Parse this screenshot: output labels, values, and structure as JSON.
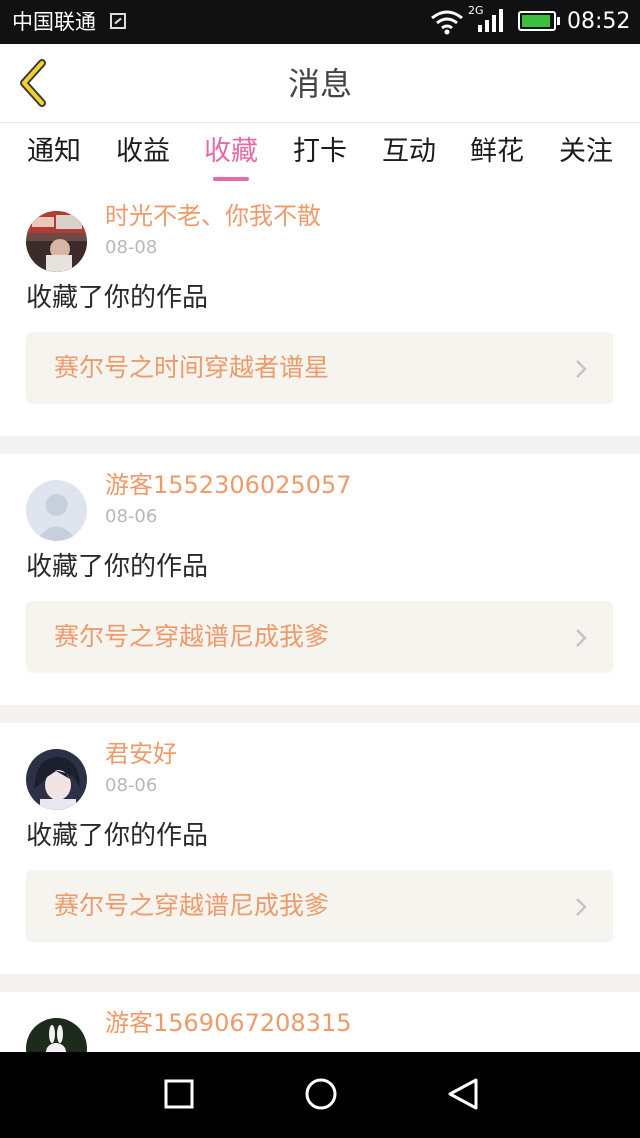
{
  "status_bar": {
    "carrier": "中国联通",
    "network_type": "2G",
    "time": "08:52",
    "icons": [
      "image-notification-icon",
      "wifi-icon",
      "signal-icon",
      "battery-charging-icon"
    ]
  },
  "header": {
    "title": "消息",
    "back_icon": "chevron-left-icon"
  },
  "tabs": [
    {
      "label": "通知",
      "active": false
    },
    {
      "label": "收益",
      "active": false
    },
    {
      "label": "收藏",
      "active": true
    },
    {
      "label": "打卡",
      "active": false
    },
    {
      "label": "互动",
      "active": false
    },
    {
      "label": "鲜花",
      "active": false
    },
    {
      "label": "关注",
      "active": false
    }
  ],
  "items": [
    {
      "username": "时光不老、你我不散",
      "date": "08-08",
      "action": "收藏了你的作品",
      "work_title": "赛尔号之时间穿越者谱星",
      "avatar": "photo-avatar"
    },
    {
      "username": "游客1552306025057",
      "date": "08-06",
      "action": "收藏了你的作品",
      "work_title": "赛尔号之穿越谱尼成我爹",
      "avatar": "default-avatar"
    },
    {
      "username": "君安好",
      "date": "08-06",
      "action": "收藏了你的作品",
      "work_title": "赛尔号之穿越谱尼成我爹",
      "avatar": "anime-avatar"
    },
    {
      "username": "游客1569067208315",
      "avatar": "rabbit-avatar"
    }
  ],
  "nav_bar": {
    "icons": [
      "recents-square-icon",
      "home-circle-icon",
      "back-triangle-icon"
    ]
  },
  "colors": {
    "accent_pink": "#e66aa3",
    "username_orange": "#ee9a6a",
    "card_box_bg": "#f5f4ee",
    "separator": "#f4f3f2"
  }
}
